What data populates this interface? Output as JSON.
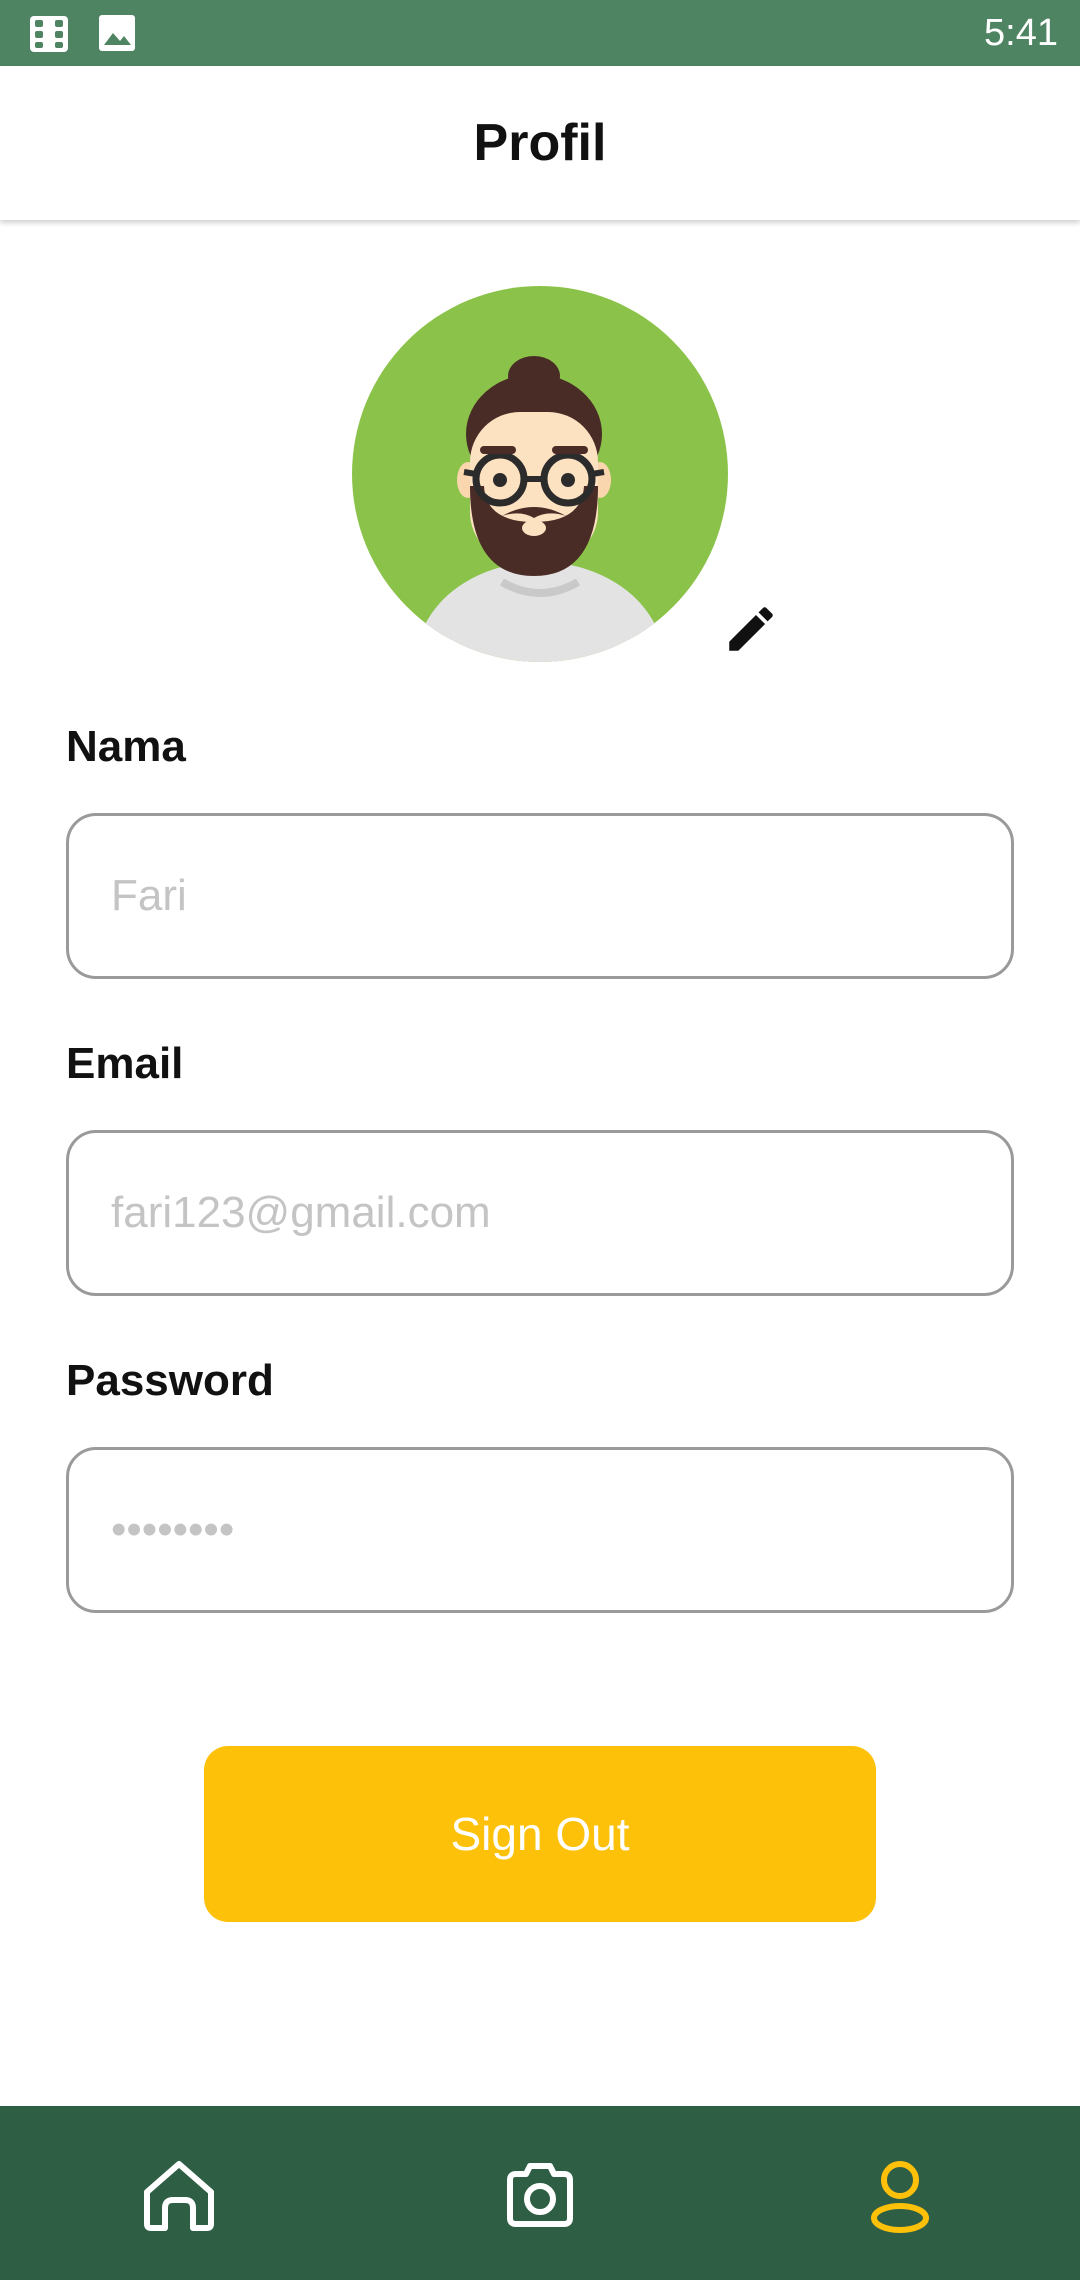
{
  "status_bar": {
    "time": "5:41",
    "icons": [
      "film-icon",
      "image-icon"
    ]
  },
  "header": {
    "title": "Profil"
  },
  "profile": {
    "avatar_bg_color": "#8bc34a",
    "edit_icon": "pencil-icon"
  },
  "form": {
    "name": {
      "label": "Nama",
      "placeholder": "Fari"
    },
    "email": {
      "label": "Email",
      "placeholder": "fari123@gmail.com"
    },
    "password": {
      "label": "Password",
      "placeholder": "••••••••"
    }
  },
  "actions": {
    "sign_out_label": "Sign Out",
    "sign_out_color": "#fdc10a"
  },
  "bottom_nav": {
    "items": [
      {
        "icon": "home-icon",
        "active": false
      },
      {
        "icon": "camera-icon",
        "active": false
      },
      {
        "icon": "profile-icon",
        "active": true
      }
    ],
    "active_color": "#fdc10a",
    "inactive_color": "#ffffff"
  }
}
